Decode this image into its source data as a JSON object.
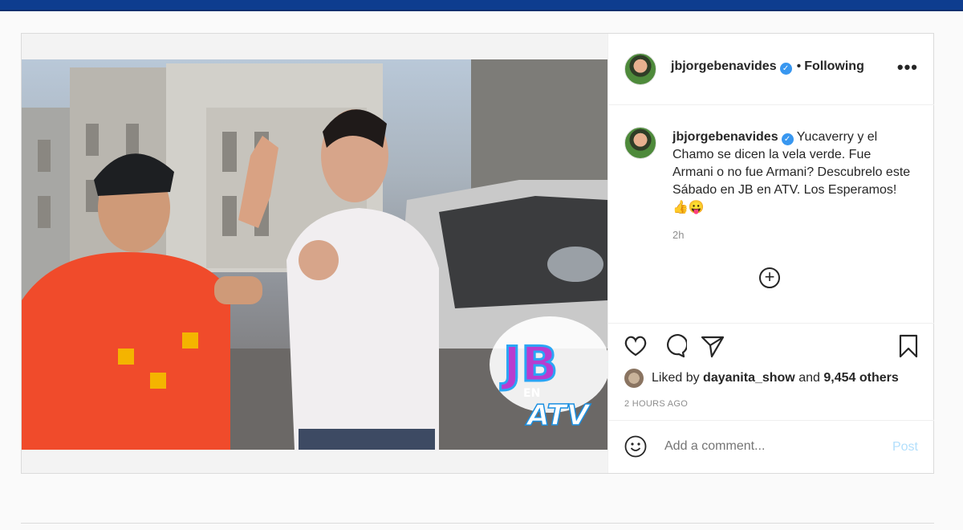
{
  "post": {
    "username": "jbjorgebenavides",
    "follow_status": "Following",
    "more_label": "•••",
    "caption": "Yucaverry y el Chamo se dicen la vela verde. Fue Armani o no fue Armani? Descubrelo este Sábado en JB en ATV. Los Esperamos! 👍😛",
    "time_short": "2h",
    "liked_by_prefix": "Liked by",
    "liked_by_user": "dayanita_show",
    "liked_by_and": "and",
    "liked_by_others": "9,454 others",
    "time_ago": "2 HOURS AGO",
    "comment_placeholder": "Add a comment...",
    "post_label": "Post"
  },
  "media": {
    "logo_text_main": "JB",
    "logo_text_en": "EN",
    "logo_text_atv": "ATV"
  },
  "colors": {
    "verified": "#3897f0",
    "post_button": "#b2dffc",
    "top_bar": "#0e3d8f"
  }
}
